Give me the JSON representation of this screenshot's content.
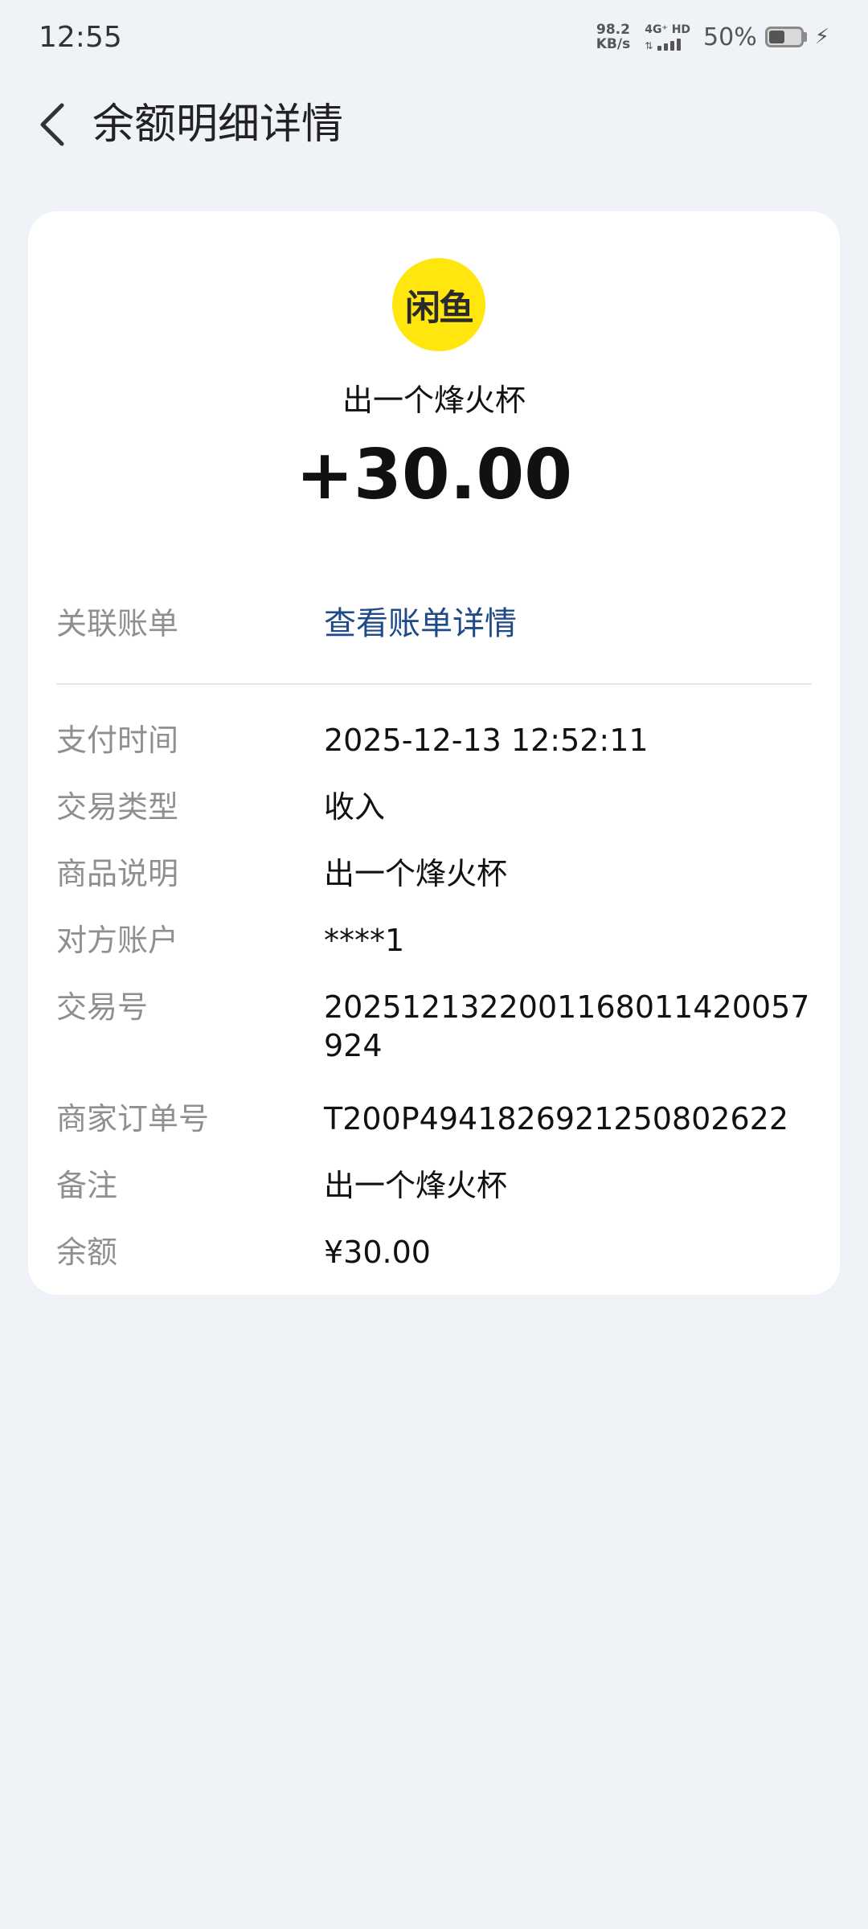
{
  "status_bar": {
    "time": "12:55",
    "net_speed_value": "98.2",
    "net_speed_unit": "KB/s",
    "network_type": "4G⁺ HD",
    "battery_percent": "50%",
    "battery_level": 0.5
  },
  "header": {
    "title": "余额明细详情",
    "back_icon": "chevron-left-icon"
  },
  "transaction": {
    "merchant_logo_text": "闲鱼",
    "merchant_logo_color": "#ffe60f",
    "merchant_name": "出一个烽火杯",
    "amount": "+30.00"
  },
  "linked_bill": {
    "label": "关联账单",
    "link_text": "查看账单详情",
    "link_color": "#1e4a8a"
  },
  "details": [
    {
      "label": "支付时间",
      "value": "2025-12-13 12:52:11"
    },
    {
      "label": "交易类型",
      "value": "收入"
    },
    {
      "label": "商品说明",
      "value": "出一个烽火杯"
    },
    {
      "label": "对方账户",
      "value": "****1"
    },
    {
      "label": "交易号",
      "value": "2025121322001168011420057924"
    },
    {
      "label": "商家订单号",
      "value": "T200P4941826921250802622"
    },
    {
      "label": "备注",
      "value": "出一个烽火杯"
    },
    {
      "label": "余额",
      "value": "¥30.00"
    }
  ]
}
